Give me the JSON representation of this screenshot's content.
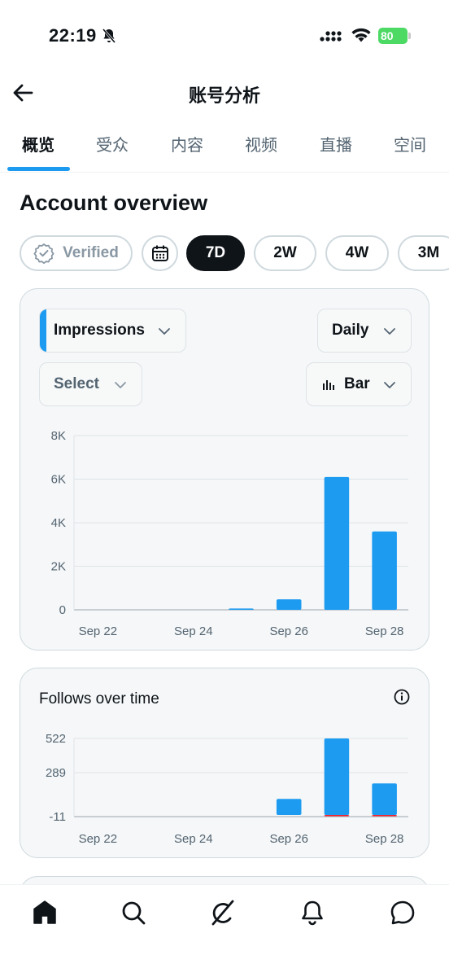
{
  "status_bar": {
    "time": "22:19",
    "battery": "80"
  },
  "header": {
    "title": "账号分析",
    "back_icon": "arrow-left-icon"
  },
  "tabs": [
    {
      "label": "概览",
      "active": true
    },
    {
      "label": "受众",
      "active": false
    },
    {
      "label": "内容",
      "active": false
    },
    {
      "label": "视频",
      "active": false
    },
    {
      "label": "直播",
      "active": false
    },
    {
      "label": "空间",
      "active": false
    }
  ],
  "section_title": "Account overview",
  "periods": {
    "verified": "Verified",
    "calendar_icon": "calendar-icon",
    "options": [
      {
        "label": "7D",
        "active": true
      },
      {
        "label": "2W",
        "active": false
      },
      {
        "label": "4W",
        "active": false
      },
      {
        "label": "3M",
        "active": false
      }
    ]
  },
  "impressions_card": {
    "metric": "Impressions",
    "granularity": "Daily",
    "compare": "Select",
    "chart_type_label": "Bar"
  },
  "follows_card": {
    "title": "Follows over time"
  },
  "colors": {
    "accent": "#1d9bf0",
    "negative": "#f4212e",
    "text": "#0f1419",
    "muted": "#536471"
  },
  "chart_data": [
    {
      "type": "bar",
      "categories": [
        "Sep 22",
        "Sep 23",
        "Sep 24",
        "Sep 25",
        "Sep 26",
        "Sep 27",
        "Sep 28"
      ],
      "x_tick_labels": [
        "Sep 22",
        "Sep 24",
        "Sep 26",
        "Sep 28"
      ],
      "series": [
        {
          "values": [
            0,
            0,
            0,
            60,
            480,
            6100,
            3600
          ]
        }
      ],
      "y_tick_labels": [
        "8K",
        "6K",
        "4K",
        "2K",
        "0"
      ],
      "y_ticks": [
        8000,
        6000,
        4000,
        2000,
        0
      ],
      "ylim": [
        0,
        8000
      ],
      "grid": true
    },
    {
      "type": "bar",
      "categories": [
        "Sep 22",
        "Sep 23",
        "Sep 24",
        "Sep 25",
        "Sep 26",
        "Sep 27",
        "Sep 28"
      ],
      "x_tick_labels": [
        "Sep 22",
        "Sep 24",
        "Sep 26",
        "Sep 28"
      ],
      "series": [
        {
          "values": [
            0,
            0,
            0,
            0,
            110,
            522,
            215
          ]
        },
        {
          "values": [
            0,
            0,
            0,
            0,
            0,
            -3,
            -3
          ]
        }
      ],
      "y_tick_labels": [
        "522",
        "289",
        "-11"
      ],
      "y_ticks": [
        522,
        289,
        -11
      ],
      "ylim": [
        -11,
        522
      ],
      "grid": true
    }
  ],
  "bottom_nav": [
    {
      "icon": "home-icon",
      "active": true
    },
    {
      "icon": "search-icon",
      "active": false
    },
    {
      "icon": "grok-icon",
      "active": false
    },
    {
      "icon": "bell-icon",
      "active": false
    },
    {
      "icon": "message-icon",
      "active": false
    }
  ]
}
